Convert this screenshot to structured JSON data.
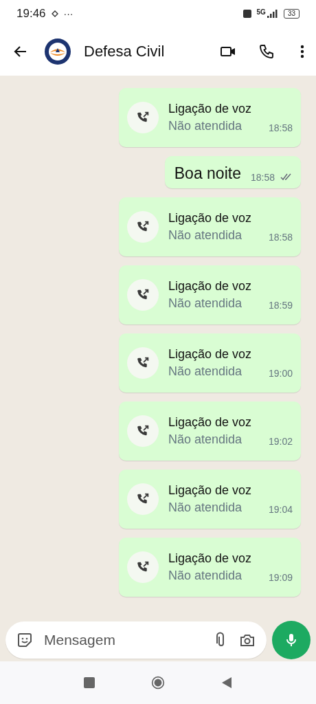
{
  "status_bar": {
    "time": "19:46",
    "more": "···",
    "network": "5G",
    "battery": "33"
  },
  "header": {
    "title": "Defesa Civil"
  },
  "messages": [
    {
      "kind": "call",
      "title": "Ligação de voz",
      "subtitle": "Não atendida",
      "time": "18:58"
    },
    {
      "kind": "text",
      "text": "Boa noite",
      "time": "18:58"
    },
    {
      "kind": "call",
      "title": "Ligação de voz",
      "subtitle": "Não atendida",
      "time": "18:58"
    },
    {
      "kind": "call",
      "title": "Ligação de voz",
      "subtitle": "Não atendida",
      "time": "18:59"
    },
    {
      "kind": "call",
      "title": "Ligação de voz",
      "subtitle": "Não atendida",
      "time": "19:00"
    },
    {
      "kind": "call",
      "title": "Ligação de voz",
      "subtitle": "Não atendida",
      "time": "19:02"
    },
    {
      "kind": "call",
      "title": "Ligação de voz",
      "subtitle": "Não atendida",
      "time": "19:04"
    },
    {
      "kind": "call",
      "title": "Ligação de voz",
      "subtitle": "Não atendida",
      "time": "19:09"
    }
  ],
  "composer": {
    "placeholder": "Mensagem"
  }
}
